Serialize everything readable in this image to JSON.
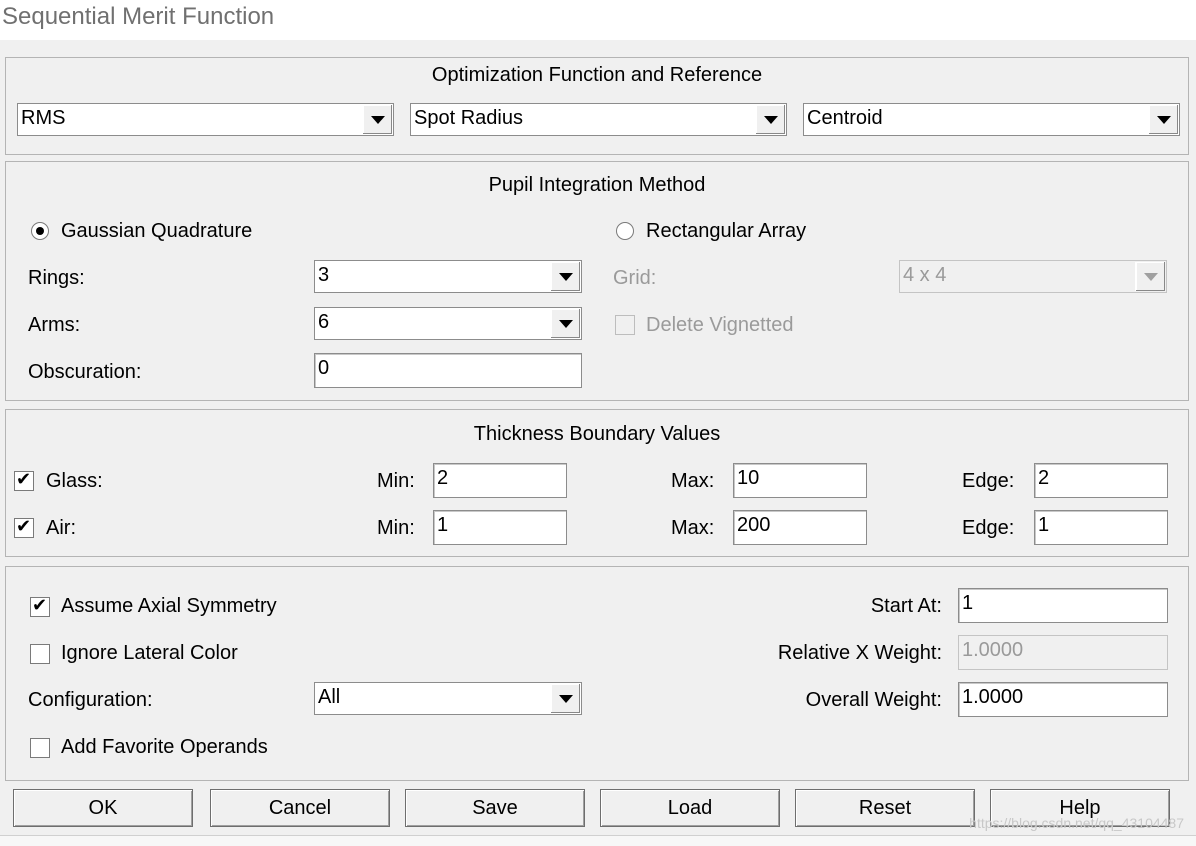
{
  "window": {
    "title": "Sequential Merit Function"
  },
  "optimization": {
    "heading": "Optimization Function and Reference",
    "function_type": "RMS",
    "criterion": "Spot Radius",
    "reference": "Centroid"
  },
  "pupil": {
    "heading": "Pupil Integration Method",
    "gaussian_label": "Gaussian Quadrature",
    "rectangular_label": "Rectangular Array",
    "selected": "Gaussian Quadrature",
    "rings_label": "Rings:",
    "rings_value": "3",
    "arms_label": "Arms:",
    "arms_value": "6",
    "obscuration_label": "Obscuration:",
    "obscuration_value": "0",
    "grid_label": "Grid:",
    "grid_value": "4 x 4",
    "delete_vignetted_label": "Delete Vignetted",
    "delete_vignetted_checked": false
  },
  "thickness": {
    "heading": "Thickness Boundary Values",
    "min_label": "Min:",
    "max_label": "Max:",
    "edge_label": "Edge:",
    "glass": {
      "label": "Glass:",
      "checked": true,
      "min": "2",
      "max": "10",
      "edge": "2"
    },
    "air": {
      "label": "Air:",
      "checked": true,
      "min": "1",
      "max": "200",
      "edge": "1"
    }
  },
  "options": {
    "assume_axial_label": "Assume Axial Symmetry",
    "assume_axial_checked": true,
    "ignore_lateral_label": "Ignore Lateral Color",
    "ignore_lateral_checked": false,
    "configuration_label": "Configuration:",
    "configuration_value": "All",
    "add_favorite_label": "Add Favorite Operands",
    "add_favorite_checked": false,
    "start_at_label": "Start At:",
    "start_at_value": "1",
    "relative_x_label": "Relative X Weight:",
    "relative_x_value": "1.0000",
    "overall_weight_label": "Overall Weight:",
    "overall_weight_value": "1.0000"
  },
  "buttons": {
    "ok": "OK",
    "cancel": "Cancel",
    "save": "Save",
    "load": "Load",
    "reset": "Reset",
    "help": "Help"
  },
  "watermark": "https://blog.csdn.net/qq_43104487"
}
